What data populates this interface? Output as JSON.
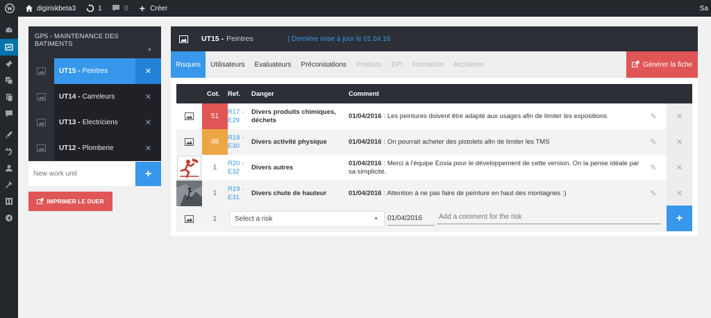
{
  "adminbar": {
    "site_name": "digiriskbeta3",
    "updates_count": "1",
    "comments_count": "0",
    "new_label": "Créer",
    "right_label": "Sa"
  },
  "adminmenu": {
    "icons": [
      "dashboard-icon",
      "digirisk-icon",
      "pin-icon",
      "media-icon",
      "pages-icon",
      "comments-icon",
      "appearance-icon",
      "plugins-icon",
      "users-icon",
      "tools-icon",
      "settings-icon",
      "collapse-icon"
    ]
  },
  "sidebar": {
    "group_title": "GP5 - MAINTENANCE DES BATIMENTS",
    "units": [
      {
        "code": "UT15 -",
        "name": "Peintres",
        "active": true
      },
      {
        "code": "UT14 -",
        "name": "Carreleurs",
        "active": false
      },
      {
        "code": "UT13 -",
        "name": "Electriciens",
        "active": false
      },
      {
        "code": "UT12 -",
        "name": "Plomberie",
        "active": false
      }
    ],
    "new_unit_placeholder": "New work unit",
    "add_symbol": "+",
    "print_label": "IMPRIMER LE DUER"
  },
  "main": {
    "unit_code": "UT15 -",
    "unit_name": "Peintres",
    "last_update": "| Dernière mise à jour le 01.04.16",
    "tabs": [
      {
        "label": "Risques",
        "state": "active"
      },
      {
        "label": "Utilisateurs",
        "state": "normal"
      },
      {
        "label": "Evaluateurs",
        "state": "normal"
      },
      {
        "label": "Préconisations",
        "state": "normal"
      },
      {
        "label": "Produits",
        "state": "disabled"
      },
      {
        "label": "EPI",
        "state": "disabled"
      },
      {
        "label": "Formation",
        "state": "disabled"
      },
      {
        "label": "Accidents",
        "state": "disabled"
      }
    ],
    "generate_label": "Générer la fiche",
    "table": {
      "headers": {
        "cot": "Cot.",
        "ref": "Ref.",
        "danger": "Danger",
        "comment": "Comment"
      },
      "rows": [
        {
          "cot": "51",
          "level": "red",
          "ref": "R17 - E29",
          "danger": "Divers produits chimiques, déchets",
          "date": "01/04/2016",
          "comment": ": Les peintures doivent être adapté aux usages afin de limiter les expositions",
          "thumb": "placeholder"
        },
        {
          "cot": "48",
          "level": "orange",
          "ref": "R18 - E30",
          "danger": "Divers activité physique",
          "date": "01/04/2016",
          "comment": ": On pourrait acheter des pistolets afin de limiter les TMS",
          "thumb": "placeholder"
        },
        {
          "cot": "1",
          "level": "none",
          "ref": "R20 - E32",
          "danger": "Divers autres",
          "date": "01/04/2016",
          "comment": ": Merci à l'équipe Eoxia pour le développement de cette version. On la pense idéale par sa simplicité.",
          "thumb": "runner"
        },
        {
          "cot": "1",
          "level": "none",
          "ref": "R19 - E31",
          "danger": "Divers chute de hauteur",
          "date": "01/04/2016",
          "comment": ": Attention à ne pas faire de peinture en haut des montagnes :)",
          "thumb": "photo"
        }
      ],
      "new_row": {
        "cot": "1",
        "select_placeholder": "Select a risk",
        "date_value": "01/04/2016",
        "comment_placeholder": "Add a comment for the risk",
        "add_symbol": "+"
      }
    }
  },
  "colors": {
    "accent": "#3797eb",
    "danger_red": "#e05555",
    "warn_orange": "#eca645",
    "dark": "#2c2f36"
  }
}
